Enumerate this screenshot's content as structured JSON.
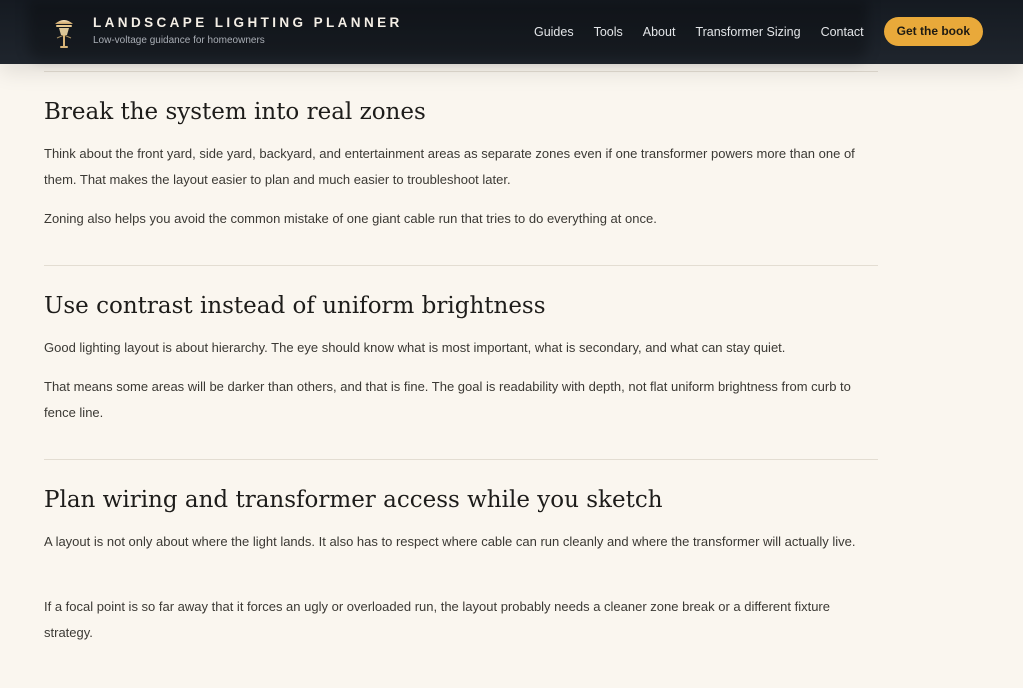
{
  "header": {
    "brand_title": "LANDSCAPE LIGHTING PLANNER",
    "brand_tagline": "Low-voltage guidance for homeowners",
    "logo_icon": "lamp-post-icon",
    "nav": [
      "Guides",
      "Tools",
      "About",
      "Transformer Sizing",
      "Contact"
    ],
    "cta_label": "Get the book",
    "accent_color": "#e9a93a",
    "background_color": "#1b2028"
  },
  "sections": [
    {
      "heading": "Break the system into real zones",
      "paragraphs": [
        "Think about the front yard, side yard, backyard, and entertainment areas as separate zones even if one transformer powers more than one of them. That makes the layout easier to plan and much easier to troubleshoot later.",
        "Zoning also helps you avoid the common mistake of one giant cable run that tries to do everything at once."
      ]
    },
    {
      "heading": "Use contrast instead of uniform brightness",
      "paragraphs": [
        "Good lighting layout is about hierarchy. The eye should know what is most important, what is secondary, and what can stay quiet.",
        "That means some areas will be darker than others, and that is fine. The goal is readability with depth, not flat uniform brightness from curb to fence line."
      ]
    },
    {
      "heading": "Plan wiring and transformer access while you sketch",
      "paragraphs": [
        "A layout is not only about where the light lands. It also has to respect where cable can run cleanly and where the transformer will actually live.",
        "If a focal point is so far away that it forces an ugly or overloaded run, the layout probably needs a cleaner zone break or a different fixture strategy."
      ]
    }
  ],
  "page_background": "#faf6ef"
}
